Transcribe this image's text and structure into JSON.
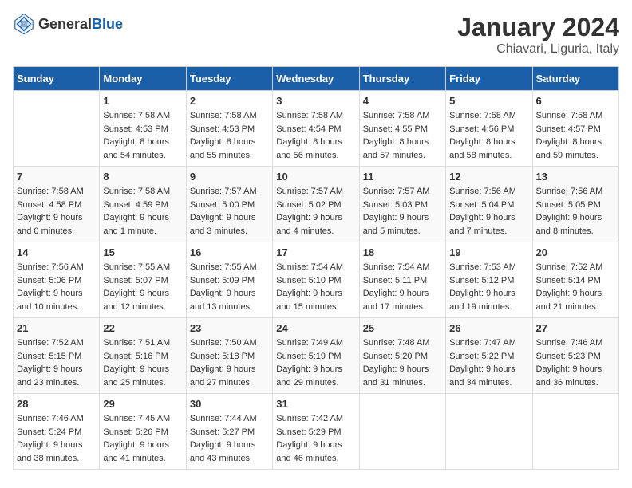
{
  "header": {
    "logo": {
      "general": "General",
      "blue": "Blue"
    },
    "month": "January 2024",
    "location": "Chiavari, Liguria, Italy"
  },
  "weekdays": [
    "Sunday",
    "Monday",
    "Tuesday",
    "Wednesday",
    "Thursday",
    "Friday",
    "Saturday"
  ],
  "weeks": [
    [
      {
        "day": "",
        "sunrise": "",
        "sunset": "",
        "daylight": ""
      },
      {
        "day": "1",
        "sunrise": "Sunrise: 7:58 AM",
        "sunset": "Sunset: 4:53 PM",
        "daylight": "Daylight: 8 hours and 54 minutes."
      },
      {
        "day": "2",
        "sunrise": "Sunrise: 7:58 AM",
        "sunset": "Sunset: 4:53 PM",
        "daylight": "Daylight: 8 hours and 55 minutes."
      },
      {
        "day": "3",
        "sunrise": "Sunrise: 7:58 AM",
        "sunset": "Sunset: 4:54 PM",
        "daylight": "Daylight: 8 hours and 56 minutes."
      },
      {
        "day": "4",
        "sunrise": "Sunrise: 7:58 AM",
        "sunset": "Sunset: 4:55 PM",
        "daylight": "Daylight: 8 hours and 57 minutes."
      },
      {
        "day": "5",
        "sunrise": "Sunrise: 7:58 AM",
        "sunset": "Sunset: 4:56 PM",
        "daylight": "Daylight: 8 hours and 58 minutes."
      },
      {
        "day": "6",
        "sunrise": "Sunrise: 7:58 AM",
        "sunset": "Sunset: 4:57 PM",
        "daylight": "Daylight: 8 hours and 59 minutes."
      }
    ],
    [
      {
        "day": "7",
        "sunrise": "Sunrise: 7:58 AM",
        "sunset": "Sunset: 4:58 PM",
        "daylight": "Daylight: 9 hours and 0 minutes."
      },
      {
        "day": "8",
        "sunrise": "Sunrise: 7:58 AM",
        "sunset": "Sunset: 4:59 PM",
        "daylight": "Daylight: 9 hours and 1 minute."
      },
      {
        "day": "9",
        "sunrise": "Sunrise: 7:57 AM",
        "sunset": "Sunset: 5:00 PM",
        "daylight": "Daylight: 9 hours and 3 minutes."
      },
      {
        "day": "10",
        "sunrise": "Sunrise: 7:57 AM",
        "sunset": "Sunset: 5:02 PM",
        "daylight": "Daylight: 9 hours and 4 minutes."
      },
      {
        "day": "11",
        "sunrise": "Sunrise: 7:57 AM",
        "sunset": "Sunset: 5:03 PM",
        "daylight": "Daylight: 9 hours and 5 minutes."
      },
      {
        "day": "12",
        "sunrise": "Sunrise: 7:56 AM",
        "sunset": "Sunset: 5:04 PM",
        "daylight": "Daylight: 9 hours and 7 minutes."
      },
      {
        "day": "13",
        "sunrise": "Sunrise: 7:56 AM",
        "sunset": "Sunset: 5:05 PM",
        "daylight": "Daylight: 9 hours and 8 minutes."
      }
    ],
    [
      {
        "day": "14",
        "sunrise": "Sunrise: 7:56 AM",
        "sunset": "Sunset: 5:06 PM",
        "daylight": "Daylight: 9 hours and 10 minutes."
      },
      {
        "day": "15",
        "sunrise": "Sunrise: 7:55 AM",
        "sunset": "Sunset: 5:07 PM",
        "daylight": "Daylight: 9 hours and 12 minutes."
      },
      {
        "day": "16",
        "sunrise": "Sunrise: 7:55 AM",
        "sunset": "Sunset: 5:09 PM",
        "daylight": "Daylight: 9 hours and 13 minutes."
      },
      {
        "day": "17",
        "sunrise": "Sunrise: 7:54 AM",
        "sunset": "Sunset: 5:10 PM",
        "daylight": "Daylight: 9 hours and 15 minutes."
      },
      {
        "day": "18",
        "sunrise": "Sunrise: 7:54 AM",
        "sunset": "Sunset: 5:11 PM",
        "daylight": "Daylight: 9 hours and 17 minutes."
      },
      {
        "day": "19",
        "sunrise": "Sunrise: 7:53 AM",
        "sunset": "Sunset: 5:12 PM",
        "daylight": "Daylight: 9 hours and 19 minutes."
      },
      {
        "day": "20",
        "sunrise": "Sunrise: 7:52 AM",
        "sunset": "Sunset: 5:14 PM",
        "daylight": "Daylight: 9 hours and 21 minutes."
      }
    ],
    [
      {
        "day": "21",
        "sunrise": "Sunrise: 7:52 AM",
        "sunset": "Sunset: 5:15 PM",
        "daylight": "Daylight: 9 hours and 23 minutes."
      },
      {
        "day": "22",
        "sunrise": "Sunrise: 7:51 AM",
        "sunset": "Sunset: 5:16 PM",
        "daylight": "Daylight: 9 hours and 25 minutes."
      },
      {
        "day": "23",
        "sunrise": "Sunrise: 7:50 AM",
        "sunset": "Sunset: 5:18 PM",
        "daylight": "Daylight: 9 hours and 27 minutes."
      },
      {
        "day": "24",
        "sunrise": "Sunrise: 7:49 AM",
        "sunset": "Sunset: 5:19 PM",
        "daylight": "Daylight: 9 hours and 29 minutes."
      },
      {
        "day": "25",
        "sunrise": "Sunrise: 7:48 AM",
        "sunset": "Sunset: 5:20 PM",
        "daylight": "Daylight: 9 hours and 31 minutes."
      },
      {
        "day": "26",
        "sunrise": "Sunrise: 7:47 AM",
        "sunset": "Sunset: 5:22 PM",
        "daylight": "Daylight: 9 hours and 34 minutes."
      },
      {
        "day": "27",
        "sunrise": "Sunrise: 7:46 AM",
        "sunset": "Sunset: 5:23 PM",
        "daylight": "Daylight: 9 hours and 36 minutes."
      }
    ],
    [
      {
        "day": "28",
        "sunrise": "Sunrise: 7:46 AM",
        "sunset": "Sunset: 5:24 PM",
        "daylight": "Daylight: 9 hours and 38 minutes."
      },
      {
        "day": "29",
        "sunrise": "Sunrise: 7:45 AM",
        "sunset": "Sunset: 5:26 PM",
        "daylight": "Daylight: 9 hours and 41 minutes."
      },
      {
        "day": "30",
        "sunrise": "Sunrise: 7:44 AM",
        "sunset": "Sunset: 5:27 PM",
        "daylight": "Daylight: 9 hours and 43 minutes."
      },
      {
        "day": "31",
        "sunrise": "Sunrise: 7:42 AM",
        "sunset": "Sunset: 5:29 PM",
        "daylight": "Daylight: 9 hours and 46 minutes."
      },
      {
        "day": "",
        "sunrise": "",
        "sunset": "",
        "daylight": ""
      },
      {
        "day": "",
        "sunrise": "",
        "sunset": "",
        "daylight": ""
      },
      {
        "day": "",
        "sunrise": "",
        "sunset": "",
        "daylight": ""
      }
    ]
  ]
}
